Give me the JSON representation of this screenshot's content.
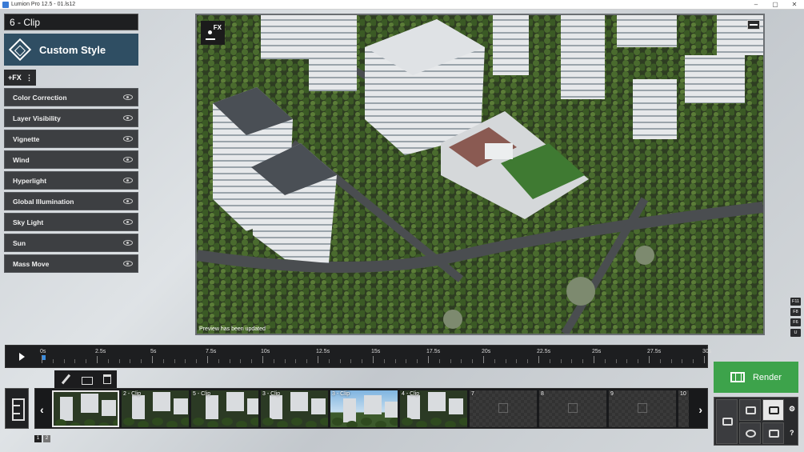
{
  "window": {
    "title": "Lumion Pro 12.5 - 01.ls12"
  },
  "clip_name": "6 - Clip",
  "style_button": "Custom Style",
  "fx_add": "+FX",
  "effects": [
    "Color Correction",
    "Layer Visibility",
    "Vignette",
    "Wind",
    "Hyperlight",
    "Global Illumination",
    "Sky Light",
    "Sun",
    "Mass Move"
  ],
  "viewport": {
    "fx_badge": "FX",
    "status": "Preview has been updated"
  },
  "keys": [
    "F11",
    "F8",
    "F6",
    "U"
  ],
  "timeline": {
    "ticks": [
      "0s",
      "2.5s",
      "5s",
      "7.5s",
      "10s",
      "12.5s",
      "15s",
      "17.5s",
      "20s",
      "22.5s",
      "25s",
      "27.5s",
      "30s"
    ]
  },
  "render_button": "Render",
  "clips": [
    {
      "label": "",
      "kind": "scene",
      "selected": true
    },
    {
      "label": "2 - Clip",
      "kind": "scene"
    },
    {
      "label": "5 - Clip",
      "kind": "scene"
    },
    {
      "label": "3 - Clip",
      "kind": "scene"
    },
    {
      "label": "3 - Clip",
      "kind": "sky"
    },
    {
      "label": "4 - Clip",
      "kind": "scene"
    },
    {
      "label": "7",
      "kind": "empty"
    },
    {
      "label": "8",
      "kind": "empty"
    },
    {
      "label": "9",
      "kind": "empty"
    },
    {
      "label": "10",
      "kind": "empty"
    }
  ],
  "pages": [
    "1",
    "2"
  ],
  "colors": {
    "render_green": "#3da34b",
    "style_blue": "#2f4e63"
  }
}
